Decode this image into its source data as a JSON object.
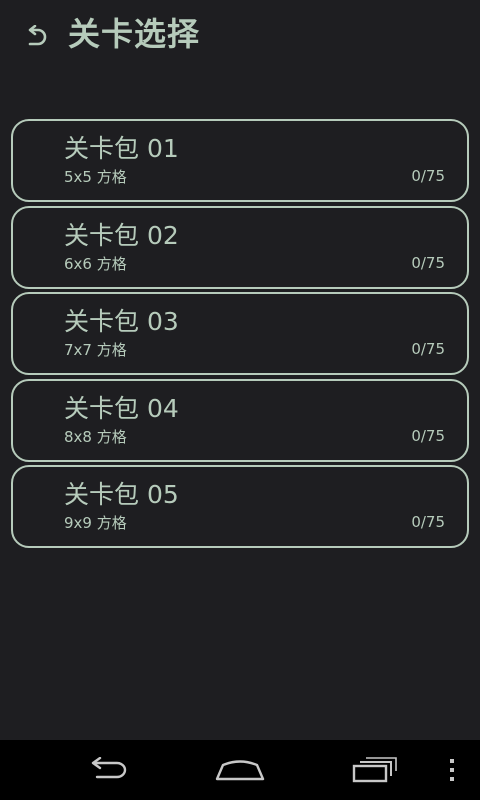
{
  "header": {
    "title": "关卡选择",
    "back_icon": "undo-back-icon"
  },
  "packs": [
    {
      "name": "关卡包 01",
      "grid": "5x5 方格",
      "progress": "0/75"
    },
    {
      "name": "关卡包 02",
      "grid": "6x6 方格",
      "progress": "0/75"
    },
    {
      "name": "关卡包 03",
      "grid": "7x7 方格",
      "progress": "0/75"
    },
    {
      "name": "关卡包 04",
      "grid": "8x8 方格",
      "progress": "0/75"
    },
    {
      "name": "关卡包 05",
      "grid": "9x9 方格",
      "progress": "0/75"
    }
  ],
  "navbar": {
    "icons": [
      "back-icon",
      "home-icon",
      "recents-icon",
      "menu-icon"
    ]
  },
  "colors": {
    "background": "#1e1e21",
    "accent": "#b6cbbb",
    "navbar": "#000000"
  }
}
